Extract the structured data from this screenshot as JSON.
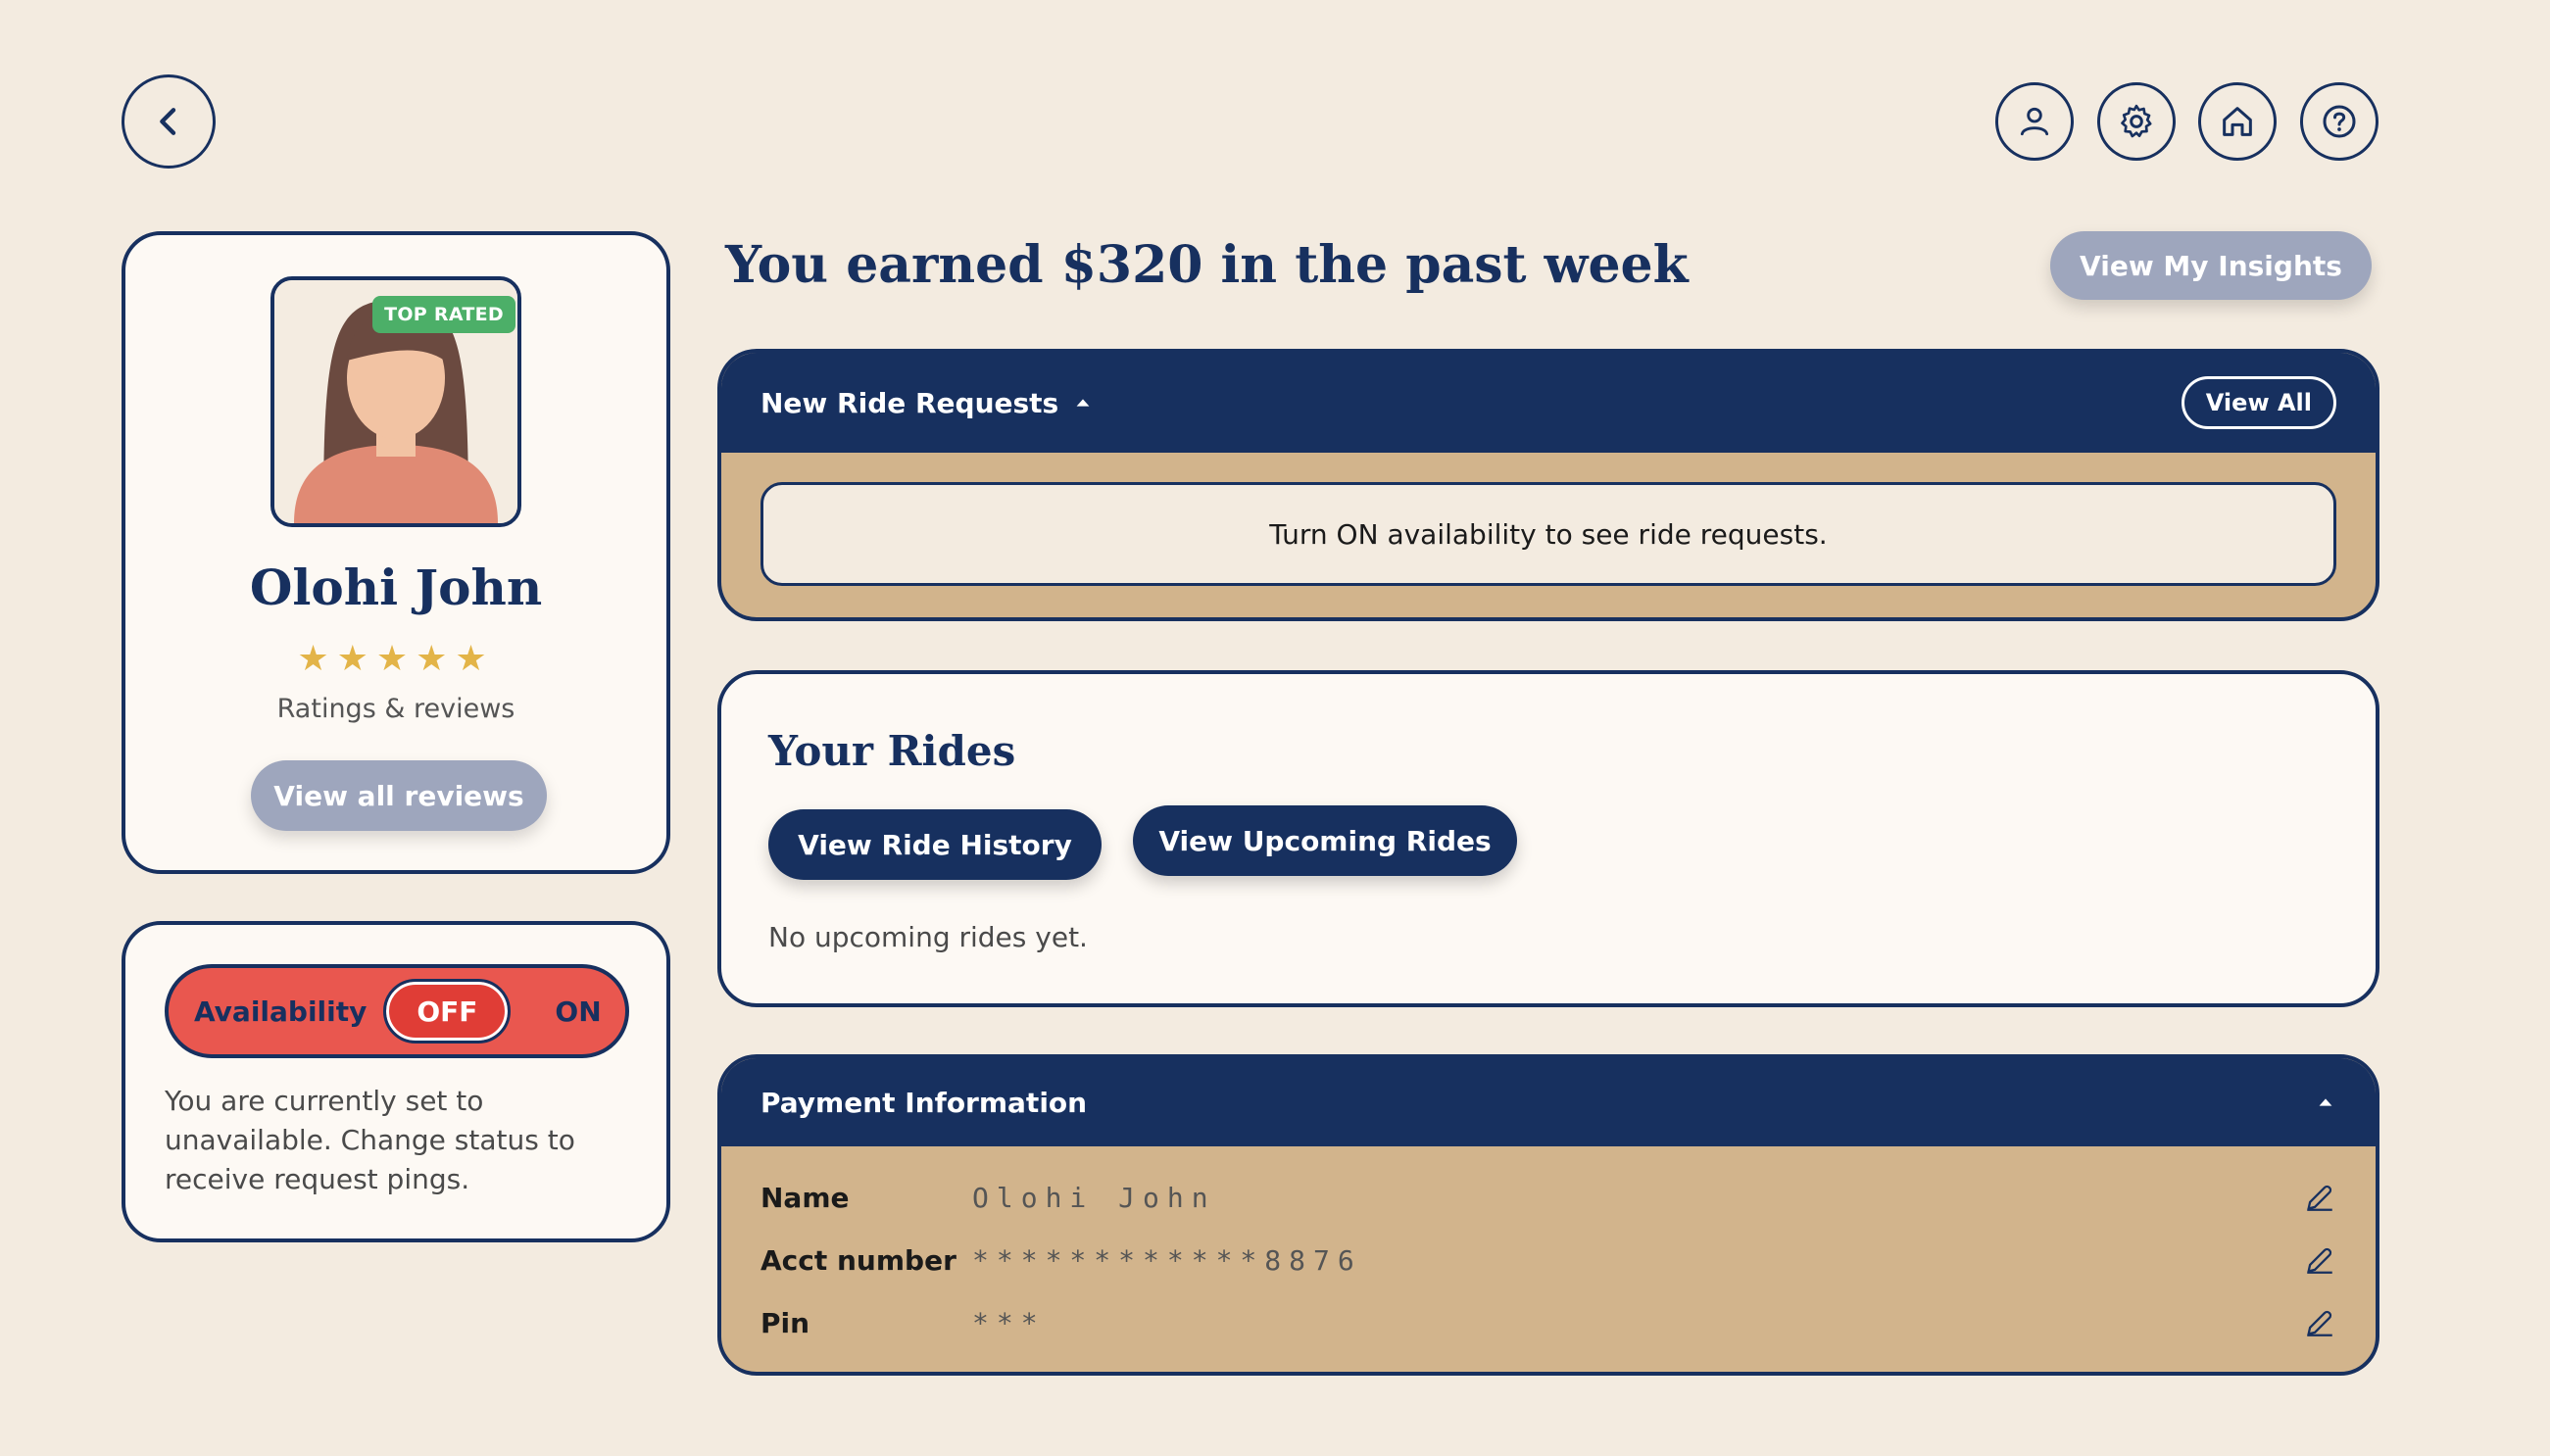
{
  "icons": {
    "back": "chevron-left-icon",
    "profile": "user-icon",
    "settings": "gear-icon",
    "home": "home-icon",
    "help": "help-icon"
  },
  "colors": {
    "navy": "#17305f",
    "background": "#f3ebe0",
    "tan": "#d2b48c",
    "availability_off": "#e9574f",
    "badge_green": "#4caf68",
    "star": "#e3b448",
    "disabled_pill": "#9ea6bd"
  },
  "profile": {
    "badge": "TOP RATED",
    "name": "Olohi John",
    "rating": 5,
    "stars": "★★★★★",
    "ratings_label": "Ratings & reviews",
    "view_reviews_label": "View all reviews"
  },
  "availability": {
    "label": "Availability",
    "off_label": "OFF",
    "on_label": "ON",
    "state": "OFF",
    "description": "You are currently set to unavailable. Change status to receive request pings."
  },
  "earnings": {
    "headline": "You earned $320 in the past week",
    "insights_label": "View My Insights"
  },
  "ride_requests": {
    "title": "New Ride Requests",
    "view_all_label": "View All",
    "message": "Turn ON availability to see ride requests."
  },
  "your_rides": {
    "title": "Your Rides",
    "history_label": "View Ride History",
    "upcoming_label": "View Upcoming Rides",
    "empty_text": "No upcoming rides yet."
  },
  "payment": {
    "title": "Payment Information",
    "rows": [
      {
        "label": "Name",
        "value": "Olohi John"
      },
      {
        "label": "Acct number",
        "value": "************8876"
      },
      {
        "label": "Pin",
        "value": "***"
      }
    ]
  }
}
